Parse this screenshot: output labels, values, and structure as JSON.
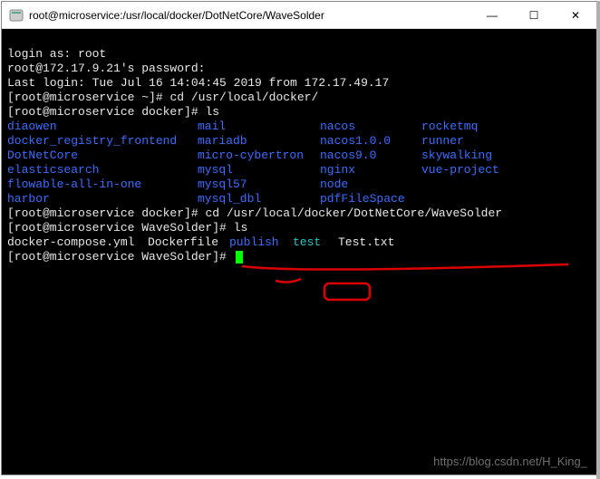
{
  "titlebar": {
    "icon_name": "terminal-icon",
    "title": "root@microservice:/usr/local/docker/DotNetCore/WaveSolder",
    "min_label": "—",
    "max_label": "☐",
    "close_label": "✕"
  },
  "session": {
    "login_prompt": "login as: root",
    "password_prompt": "root@172.17.9.21's password:",
    "last_login": "Last login: Tue Jul 16 14:04:45 2019 from 172.17.49.17",
    "prompt_home": "[root@microservice ~]# ",
    "cmd_cd1": "cd /usr/local/docker/",
    "prompt_docker": "[root@microservice docker]# ",
    "cmd_ls": "ls",
    "ls_rows": [
      [
        "diaowen",
        "mail",
        "nacos",
        "rocketmq"
      ],
      [
        "docker_registry_frontend",
        "mariadb",
        "nacos1.0.0",
        "runner"
      ],
      [
        "DotNetCore",
        "micro-cybertron",
        "nacos9.0",
        "skywalking"
      ],
      [
        "elasticsearch",
        "mysql",
        "nginx",
        "vue-project"
      ],
      [
        "flowable-all-in-one",
        "mysql57",
        "node",
        ""
      ],
      [
        "harbor",
        "mysql_dbl",
        "pdfFileSpace",
        ""
      ]
    ],
    "cmd_cd2": "cd /usr/local/docker/DotNetCore/WaveSolder",
    "prompt_wave": "[root@microservice WaveSolder]# ",
    "cmd_ls2": "ls",
    "ls2": {
      "f1": "docker-compose.yml",
      "f2": "Dockerfile",
      "dir1": "publish",
      "dir2": "test",
      "f3": "Test.txt"
    }
  },
  "watermark": "https://blog.csdn.net/H_King_"
}
